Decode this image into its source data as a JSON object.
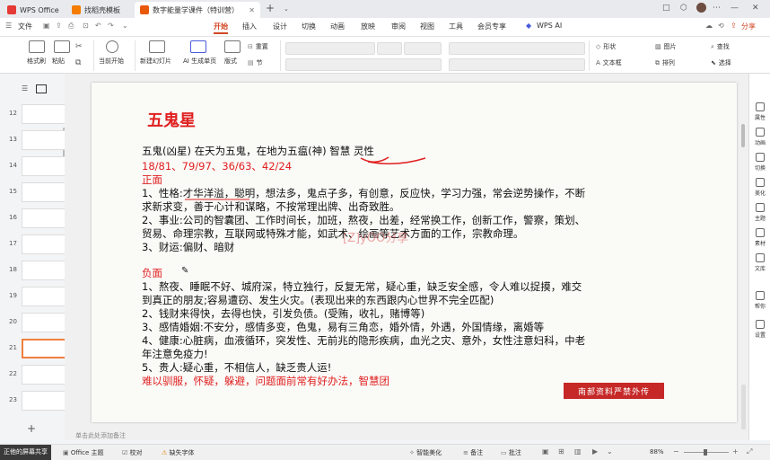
{
  "titlebar": {
    "tabs": [
      {
        "label": "WPS Office"
      },
      {
        "label": "找稻壳模板"
      },
      {
        "label": "数字能量学课件（特训营）"
      }
    ],
    "new_tab": "+",
    "window_controls": {
      "restore": "□",
      "cube": "⬡",
      "more": "⋯",
      "minimize": "—",
      "close": "✕"
    }
  },
  "menubar": {
    "file": "文件",
    "items": [
      "开始",
      "插入",
      "设计",
      "切换",
      "动画",
      "放映",
      "审阅",
      "视图",
      "工具",
      "会员专享",
      "WPS AI"
    ],
    "share": "分享"
  },
  "toolbar": {
    "format_painter": "格式刷",
    "paste": "粘贴",
    "current_start": "当前开始",
    "new_slide": "新建幻灯片",
    "ai_slide": "AI 生成单页",
    "layout": "版式",
    "reset": "重置",
    "section": "节",
    "shapes": "形状",
    "image": "图片",
    "find": "查找",
    "textbox": "文本框",
    "arrange": "排列",
    "select": "选择"
  },
  "thumbnails": {
    "numbers": [
      "12",
      "13",
      "14",
      "15",
      "16",
      "17",
      "18",
      "19",
      "20",
      "21",
      "22",
      "23"
    ],
    "selected": "21"
  },
  "slide": {
    "title": "五鬼星",
    "subtitle": "五鬼(凶星) 在天为五鬼，在地为五瘟(神) 智慧 灵性",
    "numbers": "18/81、79/97、36/63、42/24",
    "positive_heading": "正面",
    "positive": [
      "1、性格:才华洋溢，聪明，想法多，鬼点子多，有创意，反应快，学习力强，常会逆势操作，不断",
      "求新求变，善于心计和谋略，不按常理出牌、出奇致胜。",
      "2、事业:公司的智囊团、工作时间长，加班，熬夜，出差，经常换工作，创新工作，警察，策划、",
      "贸易、命理宗教，互联网或特殊才能，如武术、绘画等艺术方面的工作，宗教命理。",
      "3、财运:偏财、暗财"
    ],
    "negative_heading": "负面",
    "negative": [
      "1、熬夜、睡眠不好、城府深，特立独行，反复无常，疑心重，缺乏安全感，令人难以捉摸，难交",
      "到真正的朋友;容易遭窃、发生火灾。(表现出来的东西跟内心世界不完全匹配)",
      "2、钱财来得快，去得也快，引发负债。(受贿，收礼，赌博等)",
      "3、感情婚姻:不安分，感情多变，色鬼，易有三角恋，婚外情，外遇，外国情缘，离婚等",
      "4、健康:心脏病，血液循环，突发性、无前兆的隐形疾病，血光之灾、意外，女性注意妇科，中老",
      "年注意免疫力!",
      "5、贵人:疑心重，不相信人，缺乏贵人运!"
    ],
    "remedy": "难以驯服，怀疑，躲避，问题面前常有好办法，智慧团",
    "watermark": "[Z]yOO分享",
    "stamp": "南郝资料严禁外传"
  },
  "notes_placeholder": "单击此处添加备注",
  "rightpanel": [
    "属性",
    "动画",
    "切换",
    "美化",
    "主题",
    "素材",
    "文库",
    "帮你",
    "设置"
  ],
  "statusbar": {
    "screen_share": "正他的屏幕共享",
    "theme": "Office 主题",
    "proofread": "校对",
    "missing_font": "缺失字体",
    "smart_beautify": "智能美化",
    "notes": "备注",
    "comments": "批注",
    "zoom": "88%"
  },
  "colors": {
    "accent": "#d24726",
    "red_text": "#e02020",
    "stamp_bg": "#c62828"
  }
}
